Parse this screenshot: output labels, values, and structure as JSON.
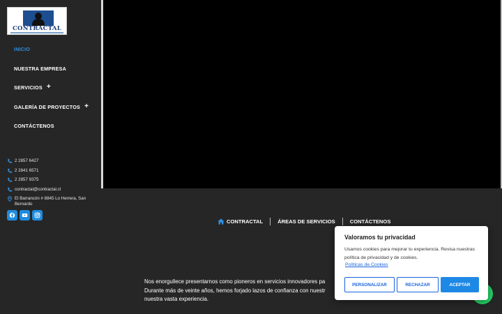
{
  "brand": {
    "logo_text": "CONTRACTAL"
  },
  "sidebar": {
    "nav": [
      {
        "label": "INICIO",
        "active": true,
        "has_submenu": false
      },
      {
        "label": "NUESTRA EMPRESA",
        "active": false,
        "has_submenu": false
      },
      {
        "label": "SERVICIOS",
        "active": false,
        "has_submenu": true
      },
      {
        "label": "GALERÍA DE PROYECTOS",
        "active": false,
        "has_submenu": true
      },
      {
        "label": "CONTÁCTENOS",
        "active": false,
        "has_submenu": false
      }
    ],
    "submenu_symbol": "+",
    "contact": {
      "phone1": "2 2857 6427",
      "phone2": "2 2841 6571",
      "phone3": "2 2857 9375",
      "email": "contractal@contractal.cl",
      "address": "El Barrancón # 8845 Lo Herrera, San Bernardo"
    },
    "social": [
      "facebook-icon",
      "youtube-icon",
      "instagram-icon"
    ]
  },
  "topnav": {
    "home_label": "CONTRACTAL",
    "services_label": "ÁREAS DE SERVICIOS",
    "contact_label": "CONTÁCTENOS"
  },
  "intro": {
    "line1": "Nos enorgullece presentarnos como pioneros en servicios innovadores pa",
    "line2": "Durante más de veinte años, hemos forjado lazos de confianza con nuestr",
    "line3": "nuestra vasta experiencia."
  },
  "cookie": {
    "title": "Valoramos tu privacidad",
    "message": "Usamos cookies para mejorar tu experiencia. Revisa nuestras política de privacidad y de cookies.",
    "link": "Políticas de Cookies",
    "customize": "PERSONALIZAR",
    "reject": "RECHAZAR",
    "accept": "ACEPTAR"
  },
  "colors": {
    "accent": "#1e88e5",
    "active_nav": "#2f8fe0",
    "sidebar_bg": "#262626",
    "hero_bg": "#000000",
    "whatsapp": "#25d366"
  }
}
